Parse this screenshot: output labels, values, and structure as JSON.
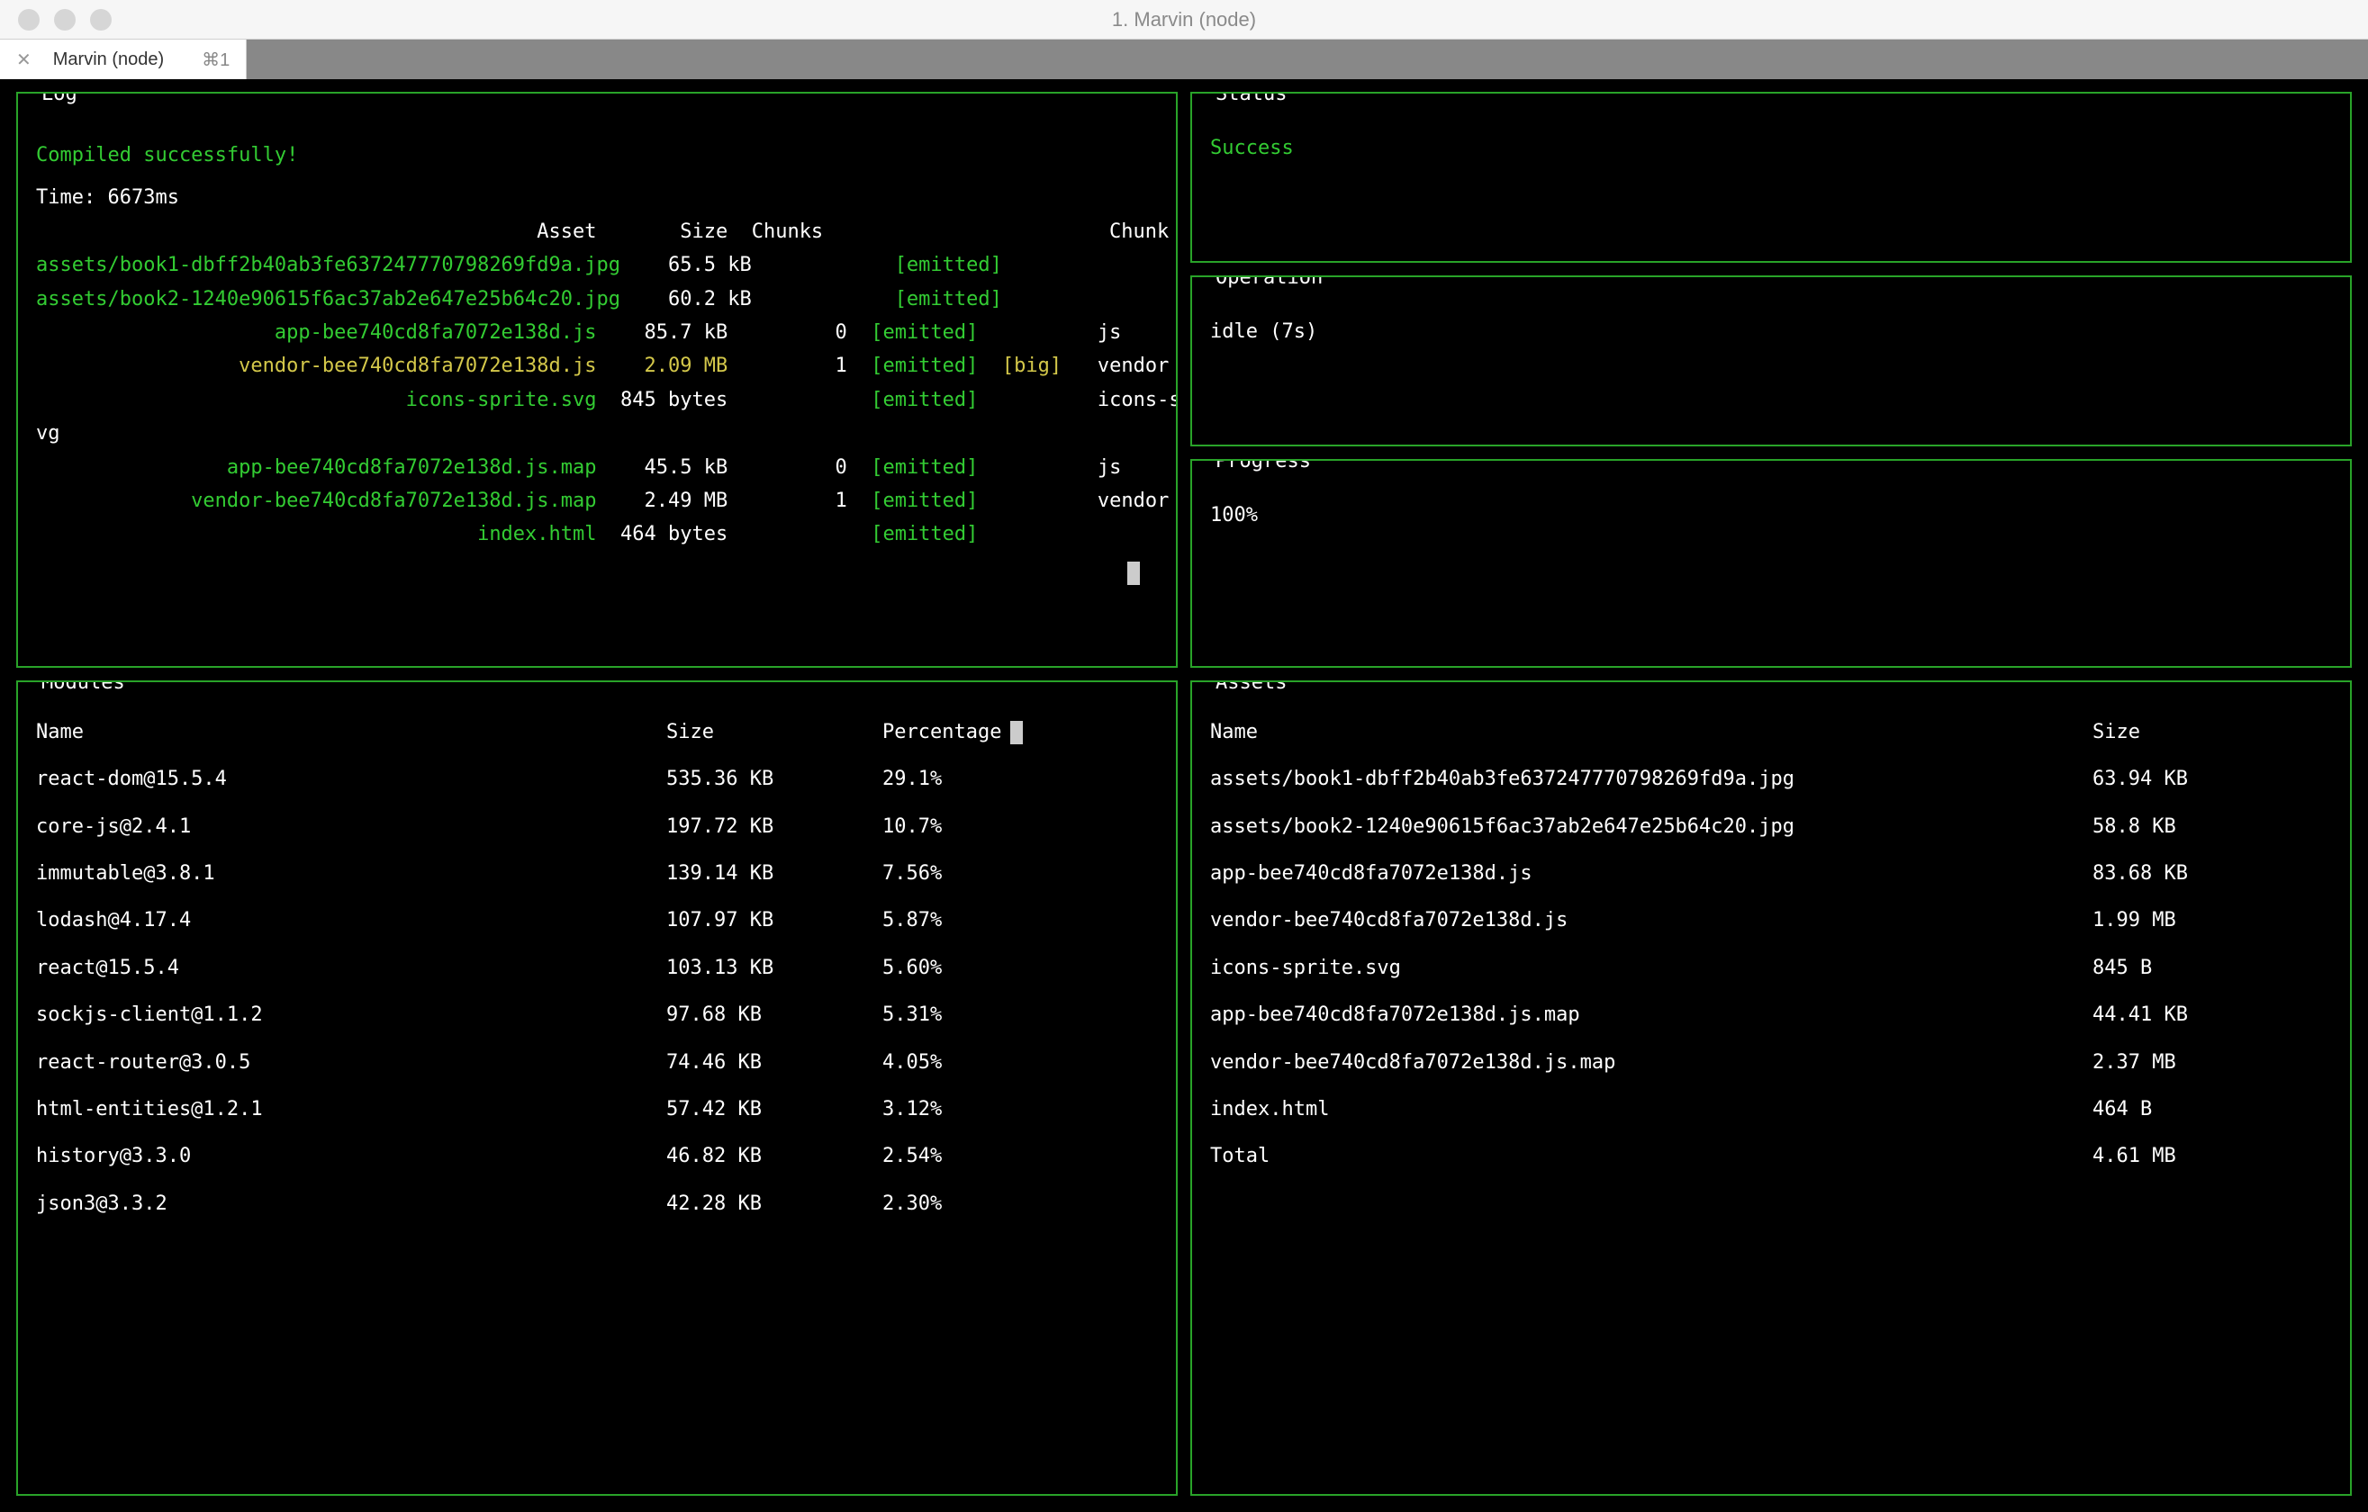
{
  "window": {
    "title": "1. Marvin (node)"
  },
  "tab": {
    "label": "Marvin (node)",
    "shortcut": "⌘1"
  },
  "log": {
    "title": "Log",
    "compiled": "Compiled successfully!",
    "time_line": "Time: 6673ms",
    "headers": {
      "asset": "Asset",
      "size": "Size",
      "chunks": "Chunks",
      "chunk_names": "Chunk Names"
    },
    "rows": [
      {
        "asset": "assets/book1-dbff2b40ab3fe637247770798269fd9a.jpg",
        "size": "65.5 kB",
        "chunk": "",
        "emitted": "[emitted]",
        "big": "",
        "name": "",
        "style": "green"
      },
      {
        "asset": "assets/book2-1240e90615f6ac37ab2e647e25b64c20.jpg",
        "size": "60.2 kB",
        "chunk": "",
        "emitted": "[emitted]",
        "big": "",
        "name": "",
        "style": "green"
      },
      {
        "asset": "app-bee740cd8fa7072e138d.js",
        "size": "85.7 kB",
        "chunk": "0",
        "emitted": "[emitted]",
        "big": "",
        "name": "js",
        "style": "green"
      },
      {
        "asset": "vendor-bee740cd8fa7072e138d.js",
        "size": "2.09 MB",
        "chunk": "1",
        "emitted": "[emitted]",
        "big": "[big]",
        "name": "vendor",
        "style": "yellow"
      },
      {
        "asset": "icons-sprite.svg",
        "size": "845 bytes",
        "chunk": "",
        "emitted": "[emitted]",
        "big": "",
        "name": "icons-sprite.svg",
        "style": "green-split"
      },
      {
        "asset": "app-bee740cd8fa7072e138d.js.map",
        "size": "45.5 kB",
        "chunk": "0",
        "emitted": "[emitted]",
        "big": "",
        "name": "js",
        "style": "green"
      },
      {
        "asset": "vendor-bee740cd8fa7072e138d.js.map",
        "size": "2.49 MB",
        "chunk": "1",
        "emitted": "[emitted]",
        "big": "",
        "name": "vendor",
        "style": "green"
      },
      {
        "asset": "index.html",
        "size": "464 bytes",
        "chunk": "",
        "emitted": "[emitted]",
        "big": "",
        "name": "",
        "style": "green"
      }
    ]
  },
  "status": {
    "title": "Status",
    "value": "Success"
  },
  "operation": {
    "title": "Operation",
    "value": "idle (7s)"
  },
  "progress": {
    "title": "Progress",
    "value": "100%"
  },
  "modules": {
    "title": "Modules",
    "headers": {
      "name": "Name",
      "size": "Size",
      "pct": "Percentage"
    },
    "rows": [
      {
        "name": "react-dom@15.5.4",
        "size": "535.36 KB",
        "pct": "29.1%"
      },
      {
        "name": "core-js@2.4.1",
        "size": "197.72 KB",
        "pct": "10.7%"
      },
      {
        "name": "immutable@3.8.1",
        "size": "139.14 KB",
        "pct": "7.56%"
      },
      {
        "name": "lodash@4.17.4",
        "size": "107.97 KB",
        "pct": "5.87%"
      },
      {
        "name": "react@15.5.4",
        "size": "103.13 KB",
        "pct": "5.60%"
      },
      {
        "name": "sockjs-client@1.1.2",
        "size": "97.68 KB",
        "pct": "5.31%"
      },
      {
        "name": "react-router@3.0.5",
        "size": "74.46 KB",
        "pct": "4.05%"
      },
      {
        "name": "html-entities@1.2.1",
        "size": "57.42 KB",
        "pct": "3.12%"
      },
      {
        "name": "history@3.3.0",
        "size": "46.82 KB",
        "pct": "2.54%"
      },
      {
        "name": "json3@3.3.2",
        "size": "42.28 KB",
        "pct": "2.30%"
      }
    ]
  },
  "assets": {
    "title": "Assets",
    "headers": {
      "name": "Name",
      "size": "Size"
    },
    "rows": [
      {
        "name": "assets/book1-dbff2b40ab3fe637247770798269fd9a.jpg",
        "size": "63.94 KB"
      },
      {
        "name": "assets/book2-1240e90615f6ac37ab2e647e25b64c20.jpg",
        "size": "58.8 KB"
      },
      {
        "name": "app-bee740cd8fa7072e138d.js",
        "size": "83.68 KB"
      },
      {
        "name": "vendor-bee740cd8fa7072e138d.js",
        "size": "1.99 MB"
      },
      {
        "name": "icons-sprite.svg",
        "size": "845 B"
      },
      {
        "name": "app-bee740cd8fa7072e138d.js.map",
        "size": "44.41 KB"
      },
      {
        "name": "vendor-bee740cd8fa7072e138d.js.map",
        "size": "2.37 MB"
      },
      {
        "name": "index.html",
        "size": "464 B"
      },
      {
        "name": "Total",
        "size": "4.61 MB"
      }
    ]
  }
}
